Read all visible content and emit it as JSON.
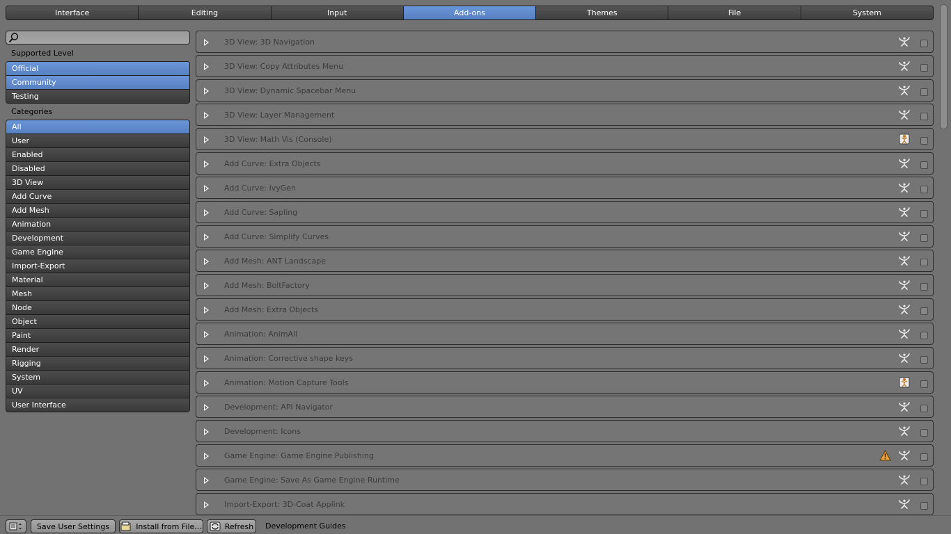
{
  "tabs": [
    {
      "label": "Interface",
      "active": false
    },
    {
      "label": "Editing",
      "active": false
    },
    {
      "label": "Input",
      "active": false
    },
    {
      "label": "Add-ons",
      "active": true
    },
    {
      "label": "Themes",
      "active": false
    },
    {
      "label": "File",
      "active": false
    },
    {
      "label": "System",
      "active": false
    }
  ],
  "search": {
    "value": "",
    "placeholder": ""
  },
  "supported_level": {
    "label": "Supported Level",
    "items": [
      {
        "label": "Official",
        "selected": true
      },
      {
        "label": "Community",
        "selected": true
      },
      {
        "label": "Testing",
        "selected": false
      }
    ]
  },
  "categories": {
    "label": "Categories",
    "items": [
      {
        "label": "All",
        "selected": true
      },
      {
        "label": "User"
      },
      {
        "label": "Enabled"
      },
      {
        "label": "Disabled"
      },
      {
        "label": "3D View"
      },
      {
        "label": "Add Curve"
      },
      {
        "label": "Add Mesh"
      },
      {
        "label": "Animation"
      },
      {
        "label": "Development"
      },
      {
        "label": "Game Engine"
      },
      {
        "label": "Import-Export"
      },
      {
        "label": "Material"
      },
      {
        "label": "Mesh"
      },
      {
        "label": "Node"
      },
      {
        "label": "Object"
      },
      {
        "label": "Paint"
      },
      {
        "label": "Render"
      },
      {
        "label": "Rigging"
      },
      {
        "label": "System"
      },
      {
        "label": "UV"
      },
      {
        "label": "User Interface"
      }
    ]
  },
  "addons": [
    {
      "name": "3D View: 3D Navigation",
      "icon": "community-icon",
      "warning": false,
      "enabled": false
    },
    {
      "name": "3D View: Copy Attributes Menu",
      "icon": "community-icon",
      "warning": false,
      "enabled": false
    },
    {
      "name": "3D View: Dynamic Spacebar Menu",
      "icon": "community-icon",
      "warning": false,
      "enabled": false
    },
    {
      "name": "3D View: Layer Management",
      "icon": "community-icon",
      "warning": false,
      "enabled": false
    },
    {
      "name": "3D View: Math Vis (Console)",
      "icon": "official-icon",
      "warning": false,
      "enabled": false
    },
    {
      "name": "Add Curve: Extra Objects",
      "icon": "community-icon",
      "warning": false,
      "enabled": false
    },
    {
      "name": "Add Curve: IvyGen",
      "icon": "community-icon",
      "warning": false,
      "enabled": false
    },
    {
      "name": "Add Curve: Sapling",
      "icon": "community-icon",
      "warning": false,
      "enabled": false
    },
    {
      "name": "Add Curve: Simplify Curves",
      "icon": "community-icon",
      "warning": false,
      "enabled": false
    },
    {
      "name": "Add Mesh: ANT Landscape",
      "icon": "community-icon",
      "warning": false,
      "enabled": false
    },
    {
      "name": "Add Mesh: BoltFactory",
      "icon": "community-icon",
      "warning": false,
      "enabled": false
    },
    {
      "name": "Add Mesh: Extra Objects",
      "icon": "community-icon",
      "warning": false,
      "enabled": false
    },
    {
      "name": "Animation: AnimAll",
      "icon": "community-icon",
      "warning": false,
      "enabled": false
    },
    {
      "name": "Animation: Corrective shape keys",
      "icon": "community-icon",
      "warning": false,
      "enabled": false
    },
    {
      "name": "Animation: Motion Capture Tools",
      "icon": "official-icon",
      "warning": false,
      "enabled": false
    },
    {
      "name": "Development: API Navigator",
      "icon": "community-icon",
      "warning": false,
      "enabled": false
    },
    {
      "name": "Development: Icons",
      "icon": "community-icon",
      "warning": false,
      "enabled": false
    },
    {
      "name": "Game Engine: Game Engine Publishing",
      "icon": "community-icon",
      "warning": true,
      "enabled": false
    },
    {
      "name": "Game Engine: Save As Game Engine Runtime",
      "icon": "community-icon",
      "warning": false,
      "enabled": false
    },
    {
      "name": "Import-Export: 3D-Coat Applink",
      "icon": "community-icon",
      "warning": false,
      "enabled": false
    }
  ],
  "bottom": {
    "save_label": "Save User Settings",
    "install_label": "Install from File...",
    "refresh_label": "Refresh",
    "guides_label": "Development Guides"
  },
  "colors": {
    "accent": "#5680c2",
    "background": "#727272",
    "button": "#3f3f3f"
  }
}
